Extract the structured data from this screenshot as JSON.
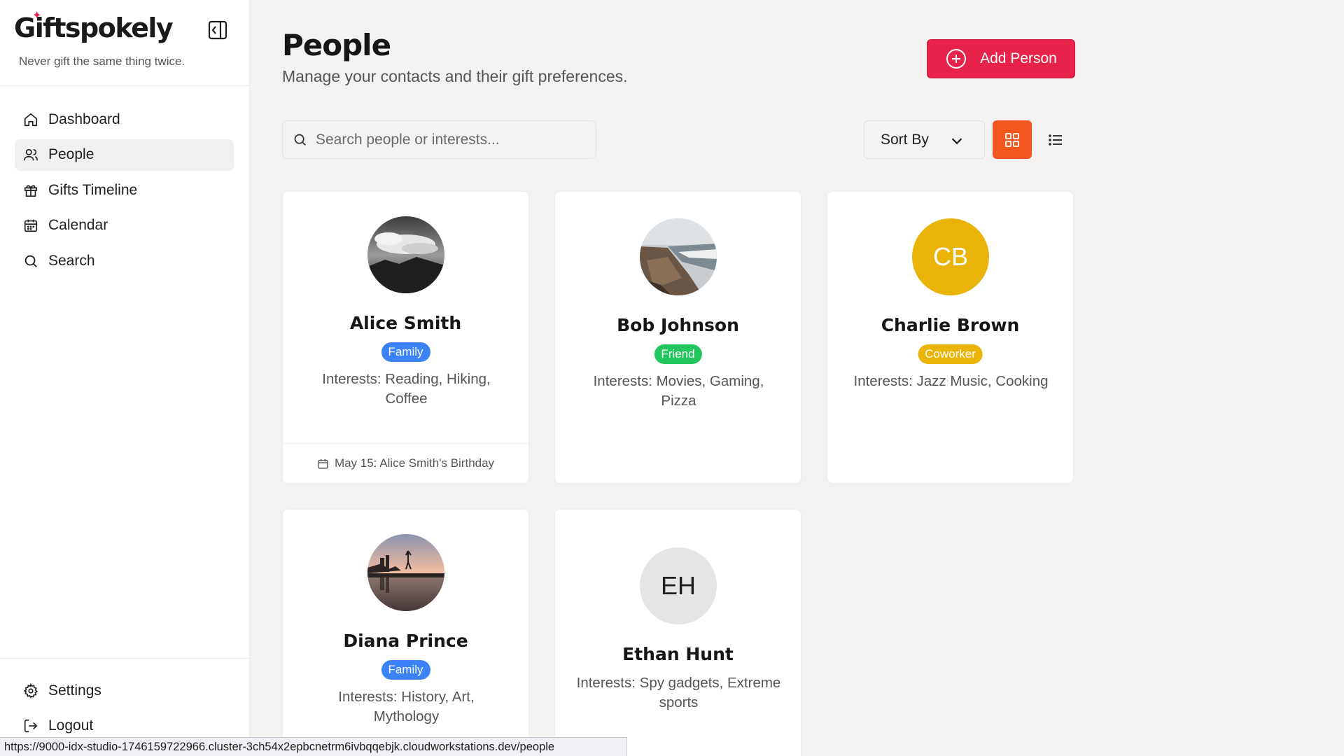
{
  "app": {
    "name": "Giftspokely",
    "tagline": "Never gift the same thing twice."
  },
  "sidebar": {
    "items": [
      {
        "label": "Dashboard",
        "icon": "home-icon"
      },
      {
        "label": "People",
        "icon": "users-icon",
        "active": true
      },
      {
        "label": "Gifts Timeline",
        "icon": "gift-icon"
      },
      {
        "label": "Calendar",
        "icon": "calendar-icon"
      },
      {
        "label": "Search",
        "icon": "search-icon"
      }
    ],
    "bottom_items": [
      {
        "label": "Settings",
        "icon": "gear-icon"
      },
      {
        "label": "Logout",
        "icon": "logout-icon"
      }
    ]
  },
  "header": {
    "title": "People",
    "subtitle": "Manage your contacts and their gift preferences.",
    "add_button_label": "Add Person"
  },
  "toolbar": {
    "search_placeholder": "Search people or interests...",
    "sort_label": "Sort By",
    "view_mode": "grid"
  },
  "people": [
    {
      "name": "Alice Smith",
      "relation": "Family",
      "interests": "Interests: Reading, Hiking, Coffee",
      "avatar": "photo-mountain-clouds",
      "footer": "May 15: Alice Smith's Birthday"
    },
    {
      "name": "Bob Johnson",
      "relation": "Friend",
      "interests": "Interests: Movies, Gaming, Pizza",
      "avatar": "photo-coastline"
    },
    {
      "name": "Charlie Brown",
      "relation": "Coworker",
      "interests": "Interests: Jazz Music, Cooking",
      "initials": "CB"
    },
    {
      "name": "Diana Prince",
      "relation": "Family",
      "interests": "Interests: History, Art, Mythology",
      "avatar": "photo-sunset-reflection"
    },
    {
      "name": "Ethan Hunt",
      "relation": "",
      "interests": "Interests: Spy gadgets, Extreme sports",
      "initials": "EH"
    }
  ],
  "colors": {
    "accent": "#e8234a",
    "view_toggle_active": "#f4561f",
    "family_badge": "#3b82f6",
    "friend_badge": "#22c55e",
    "coworker_badge": "#eab308",
    "initials_cb_bg": "#eab308",
    "initials_eh_bg": "#e5e5e5"
  },
  "status_bar": {
    "url": "https://9000-idx-studio-1746159722966.cluster-3ch54x2epbcnetrm6ivbqqebjk.cloudworkstations.dev/people"
  }
}
